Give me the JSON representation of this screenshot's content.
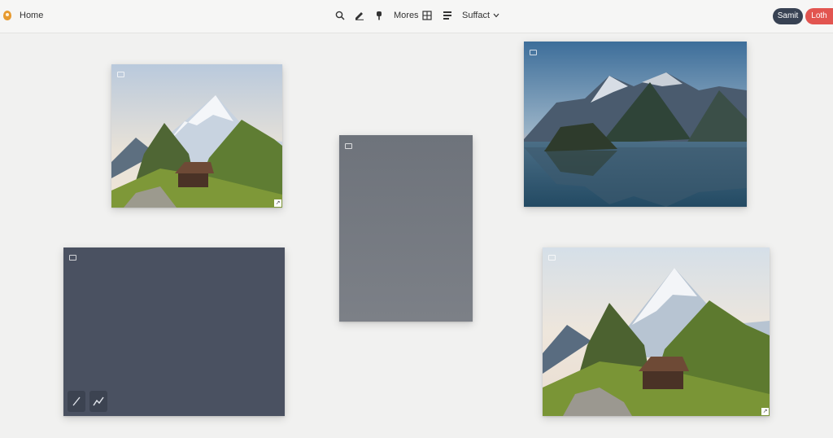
{
  "topbar": {
    "home_label": "Home",
    "more_label": "Mores",
    "sort_label": "Suffact",
    "submit_label": "Samit",
    "logout_label": "Loth",
    "icons": [
      "logo-icon",
      "search-icon",
      "edit-icon",
      "pin-icon",
      "grid-icon",
      "list-icon",
      "chevron-down-icon"
    ]
  },
  "colors": {
    "background": "#f1f1f0",
    "dark_button": "#384253",
    "red_button": "#e25550",
    "dark_card": "#4a5161",
    "gray_card": "#74787f"
  },
  "cards": [
    {
      "kind": "photo",
      "subject": "mountain-with-cabin"
    },
    {
      "kind": "placeholder",
      "subject": "gray-panel"
    },
    {
      "kind": "photo",
      "subject": "mountain-lake-reflection"
    },
    {
      "kind": "placeholder",
      "subject": "dark-panel"
    },
    {
      "kind": "photo",
      "subject": "mountain-with-cabin"
    }
  ],
  "canvas_tools": [
    "line-tool-icon",
    "polyline-tool-icon"
  ],
  "corner_glyph": "↗"
}
